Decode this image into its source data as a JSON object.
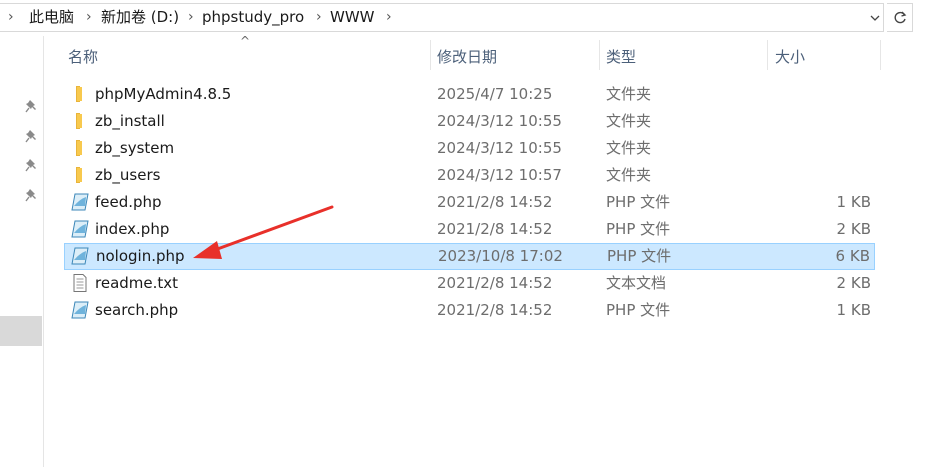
{
  "address": {
    "crumbs": [
      "此电脑",
      "新加卷 (D:)",
      "phpstudy_pro",
      "WWW"
    ]
  },
  "columns": {
    "name": "名称",
    "date": "修改日期",
    "type": "类型",
    "size": "大小"
  },
  "files": [
    {
      "name": "phpMyAdmin4.8.5",
      "date": "2025/4/7 10:25",
      "type": "文件夹",
      "size": "",
      "icon": "folder-icon"
    },
    {
      "name": "zb_install",
      "date": "2024/3/12 10:55",
      "type": "文件夹",
      "size": "",
      "icon": "folder-icon"
    },
    {
      "name": "zb_system",
      "date": "2024/3/12 10:55",
      "type": "文件夹",
      "size": "",
      "icon": "folder-icon"
    },
    {
      "name": "zb_users",
      "date": "2024/3/12 10:57",
      "type": "文件夹",
      "size": "",
      "icon": "folder-icon"
    },
    {
      "name": "feed.php",
      "date": "2021/2/8 14:52",
      "type": "PHP 文件",
      "size": "1 KB",
      "icon": "php-file-icon"
    },
    {
      "name": "index.php",
      "date": "2021/2/8 14:52",
      "type": "PHP 文件",
      "size": "2 KB",
      "icon": "php-file-icon"
    },
    {
      "name": "nologin.php",
      "date": "2023/10/8 17:02",
      "type": "PHP 文件",
      "size": "6 KB",
      "icon": "php-file-icon",
      "selected": true
    },
    {
      "name": "readme.txt",
      "date": "2021/2/8 14:52",
      "type": "文本文档",
      "size": "2 KB",
      "icon": "text-file-icon"
    },
    {
      "name": "search.php",
      "date": "2021/2/8 14:52",
      "type": "PHP 文件",
      "size": "1 KB",
      "icon": "php-file-icon"
    }
  ],
  "colors": {
    "selection_bg": "#cce8ff",
    "selection_border": "#99d1ff",
    "annotation_arrow": "#e8302a",
    "folder": "#f8c94e"
  }
}
